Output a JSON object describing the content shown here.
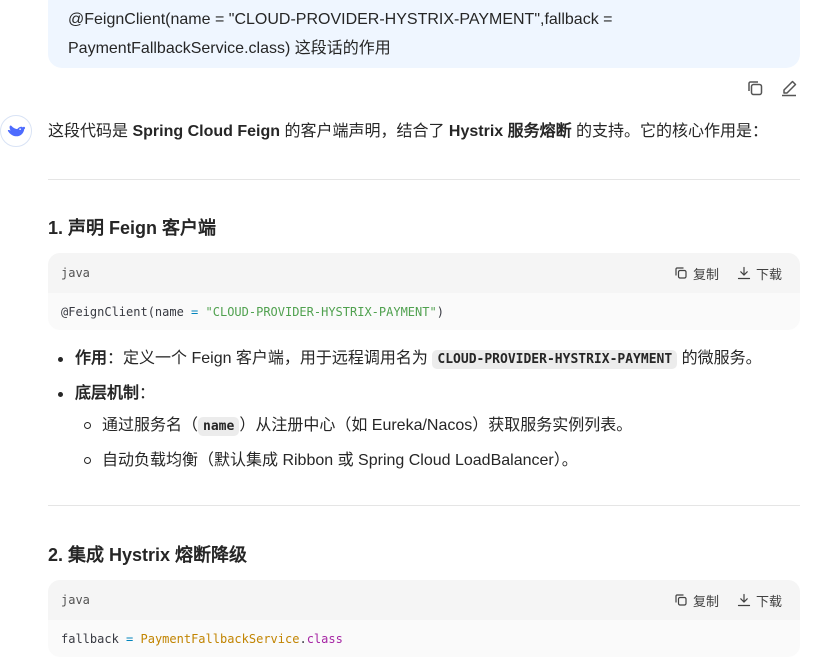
{
  "user_message": {
    "line1": "@FeignClient(name = \"CLOUD-PROVIDER-HYSTRIX-PAYMENT\",fallback =",
    "line2": "PaymentFallbackService.class)  这段话的作用"
  },
  "bubble_actions": {
    "copy_icon": "copy-icon",
    "edit_icon": "edit-icon"
  },
  "assistant": {
    "intro": {
      "p1": "这段代码是 ",
      "b1": "Spring Cloud Feign",
      "p2": " 的客户端声明，结合了 ",
      "b2": "Hystrix 服务熔断",
      "p3": " 的支持。它的核心作用是："
    },
    "sections": [
      {
        "heading": "1. 声明 Feign 客户端",
        "code": {
          "lang": "java",
          "copy_label": "复制",
          "download_label": "下载",
          "tokens": {
            "t1": "@FeignClient(name ",
            "t2": "=",
            "t3": " ",
            "t4": "\"CLOUD-PROVIDER-HYSTRIX-PAYMENT\"",
            "t5": ")"
          }
        },
        "bullets": {
          "b1_label": "作用",
          "b1_text1": "：定义一个 Feign 客户端，用于远程调用名为 ",
          "b1_code": "CLOUD-PROVIDER-HYSTRIX-PAYMENT",
          "b1_text2": " 的微服务。",
          "b2_label": "底层机制",
          "b2_text": "：",
          "sub1_text1": "通过服务名（",
          "sub1_code": "name",
          "sub1_text2": "）从注册中心（如 Eureka/Nacos）获取服务实例列表。",
          "sub2_text": "自动负载均衡（默认集成 Ribbon 或 Spring Cloud LoadBalancer）。"
        }
      },
      {
        "heading": "2. 集成 Hystrix 熔断降级",
        "code": {
          "lang": "java",
          "copy_label": "复制",
          "download_label": "下载",
          "tokens": {
            "t1": "fallback ",
            "t2": "=",
            "t3": " ",
            "t4": "PaymentFallbackService",
            "t5": ".",
            "t6": "class"
          }
        }
      }
    ]
  },
  "colors": {
    "bubble_bg": "#eff6ff",
    "brand_blue": "#4d6bfe",
    "code_string": "#50a14f",
    "code_class": "#c18401",
    "code_keyword": "#a626a4"
  }
}
